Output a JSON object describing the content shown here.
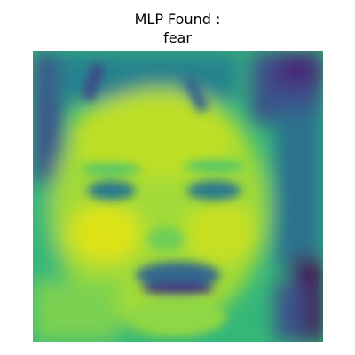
{
  "figure": {
    "title_line1": "MLP Found :",
    "title_line2": "fear",
    "colormap": "viridis",
    "image_subject": "grayscale face with a fearful expression rendered in viridis colormap"
  }
}
